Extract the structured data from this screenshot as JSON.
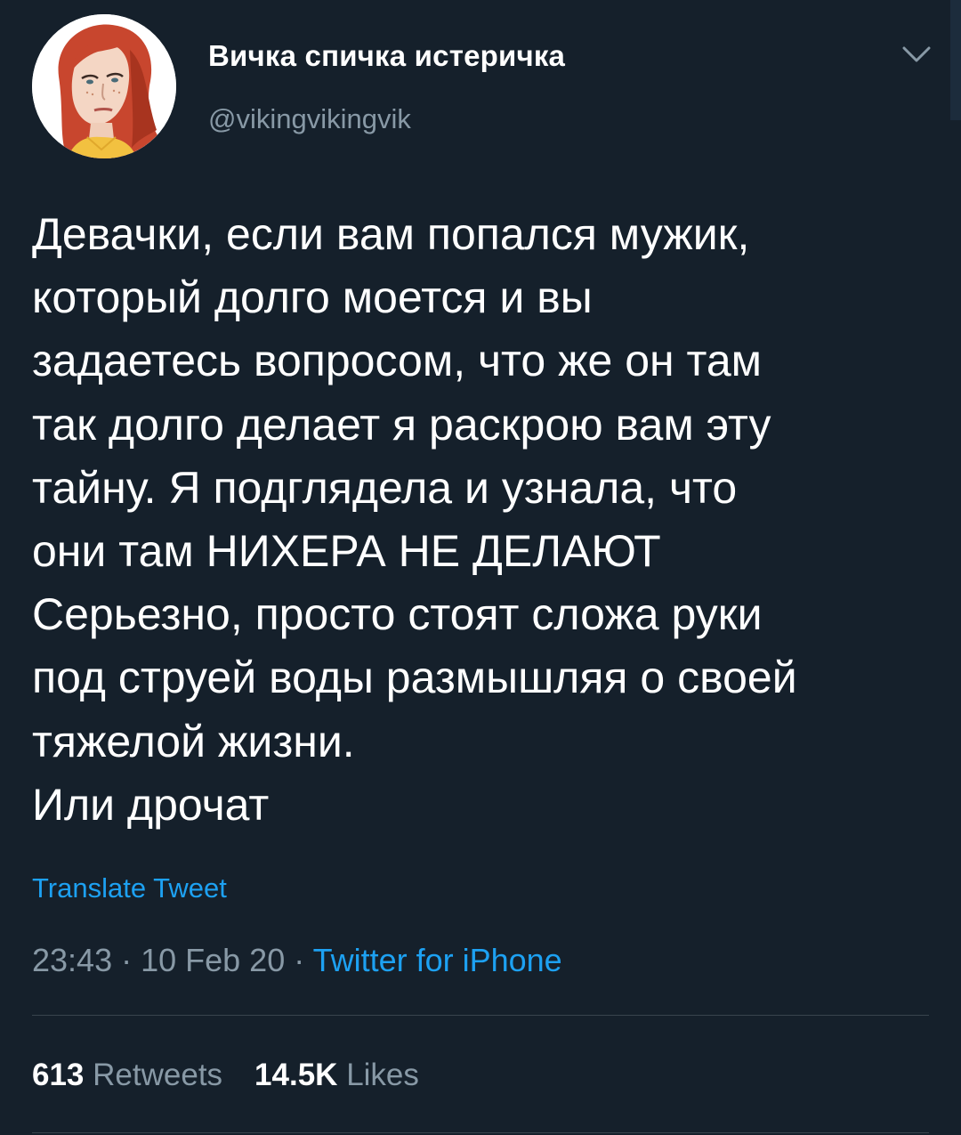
{
  "user": {
    "display_name": "Вичка спичка истеричка",
    "handle": "@vikingvikingvik",
    "avatar_icon": "avatar-illustration-red-hair"
  },
  "header": {
    "menu_icon": "chevron-down-icon"
  },
  "tweet": {
    "text": "Девачки, если вам попался мужик,\nкоторый долго моется и вы\nзадаетесь вопросом, что же он там\nтак долго делает я раскрою вам эту\nтайну. Я подглядела и узнала, что\nони там НИХЕРА НЕ ДЕЛАЮТ\nСерьезно, просто стоят сложа руки\nпод струей воды размышляя о своей\nтяжелой жизни.\nИли дрочат",
    "translate_label": "Translate Tweet"
  },
  "meta": {
    "time": "23:43",
    "date": "10 Feb 20",
    "separator": " · ",
    "source": "Twitter for iPhone"
  },
  "stats": {
    "retweets_count": "613",
    "retweets_label": "Retweets",
    "likes_count": "14.5K",
    "likes_label": "Likes"
  },
  "colors": {
    "background": "#15202b",
    "text_primary": "#ffffff",
    "text_secondary": "#8899a6",
    "accent": "#1da1f2",
    "divider": "#38444d"
  }
}
